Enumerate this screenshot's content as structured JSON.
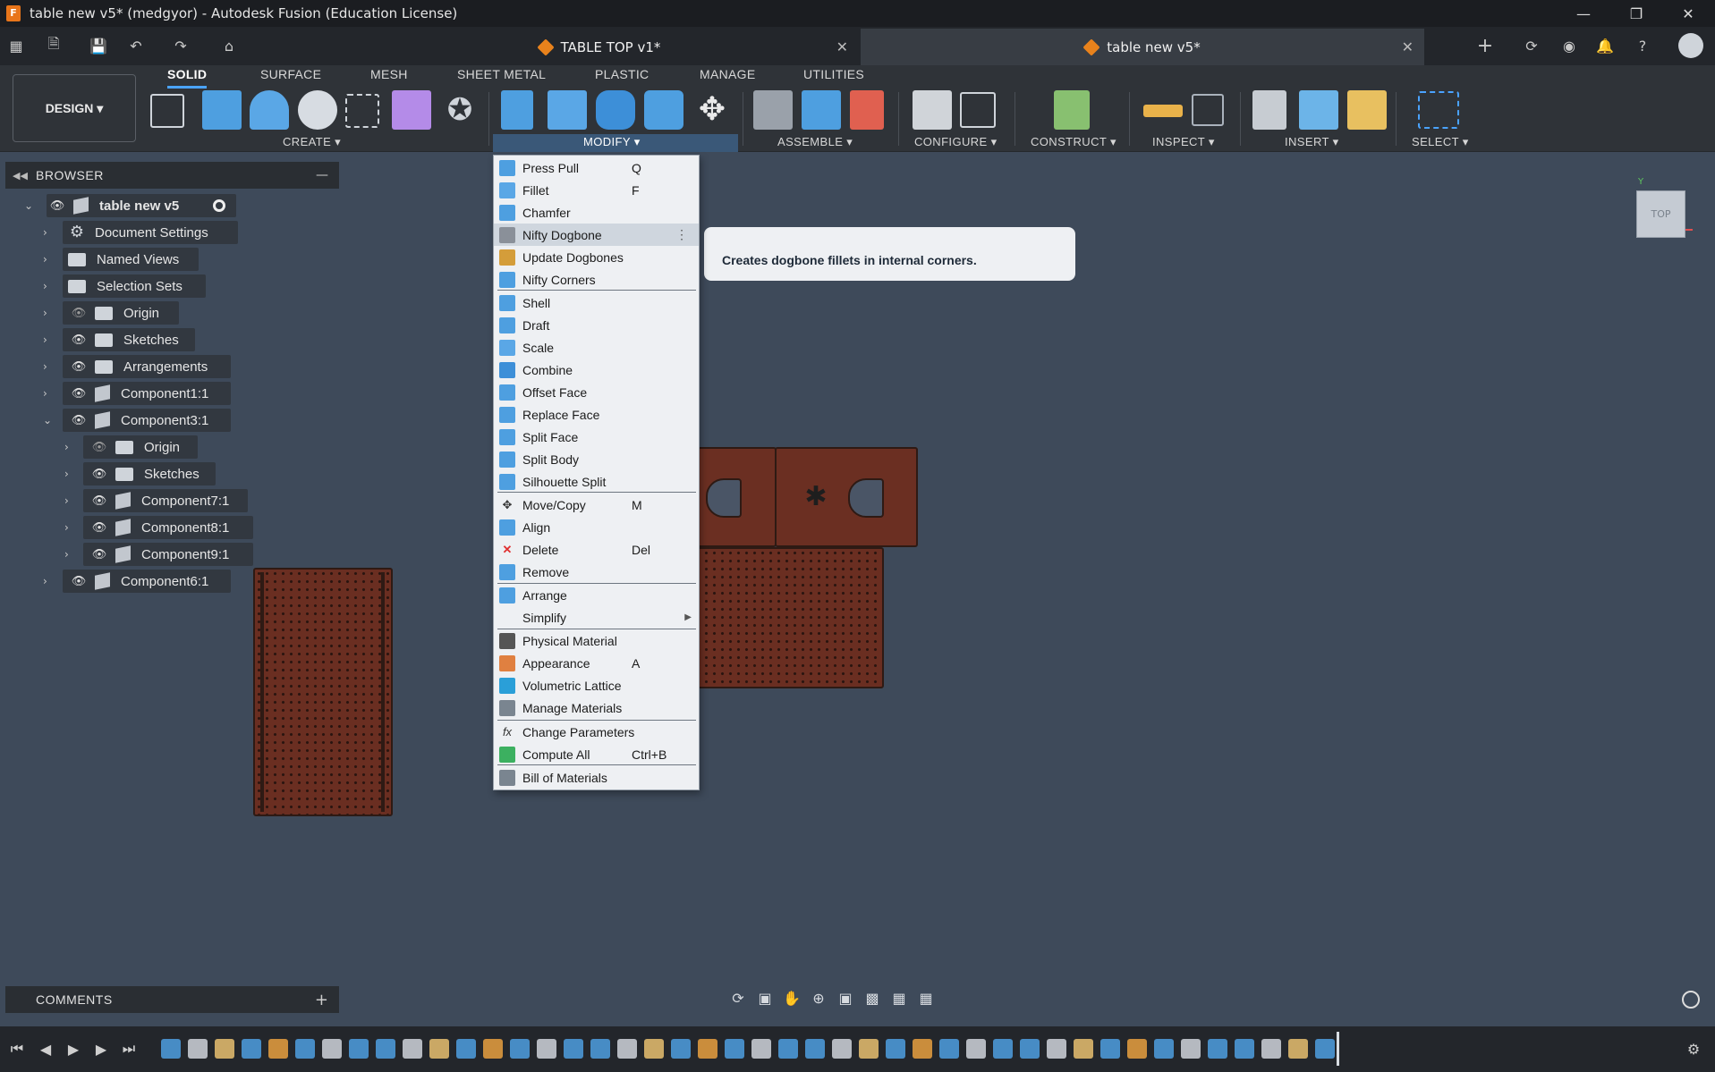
{
  "window": {
    "title": "table new v5* (medgyor) - Autodesk Fusion (Education License)",
    "app_icon_letter": "F",
    "controls": [
      "minimize-icon",
      "restore-icon",
      "close-icon"
    ]
  },
  "doc_tabs": [
    {
      "label": "TABLE TOP v1*",
      "active": false
    },
    {
      "label": "table new v5*",
      "active": true
    }
  ],
  "toolbar": {
    "workspace": "DESIGN",
    "workspace_tabs": [
      "SOLID",
      "SURFACE",
      "MESH",
      "SHEET METAL",
      "PLASTIC",
      "MANAGE",
      "UTILITIES"
    ],
    "groups": [
      "CREATE",
      "MODIFY",
      "ASSEMBLE",
      "CONFIGURE",
      "CONSTRUCT",
      "INSPECT",
      "INSERT",
      "SELECT"
    ]
  },
  "browser": {
    "title": "BROWSER",
    "root": "table new v5",
    "items": [
      {
        "label": "Document Settings"
      },
      {
        "label": "Named Views"
      },
      {
        "label": "Selection Sets"
      },
      {
        "label": "Origin"
      },
      {
        "label": "Sketches"
      },
      {
        "label": "Arrangements"
      },
      {
        "label": "Component1:1"
      },
      {
        "label": "Component3:1"
      },
      {
        "label": "Origin"
      },
      {
        "label": "Sketches"
      },
      {
        "label": "Component7:1"
      },
      {
        "label": "Component8:1"
      },
      {
        "label": "Component9:1"
      },
      {
        "label": "Component6:1"
      }
    ]
  },
  "comments": {
    "title": "COMMENTS"
  },
  "modify_menu": {
    "items": [
      {
        "label": "Press Pull",
        "shortcut": "Q",
        "icon": "press-pull-icon"
      },
      {
        "label": "Fillet",
        "shortcut": "F",
        "icon": "fillet-icon"
      },
      {
        "label": "Chamfer",
        "shortcut": "",
        "icon": "chamfer-icon"
      },
      {
        "label": "Nifty Dogbone",
        "shortcut": "",
        "icon": "dogbone-icon"
      },
      {
        "label": "Update Dogbones",
        "shortcut": "",
        "icon": "update-dogbones-icon"
      },
      {
        "label": "Nifty Corners",
        "shortcut": "",
        "icon": "corners-icon"
      },
      {
        "label": "Shell",
        "shortcut": "",
        "icon": "shell-icon"
      },
      {
        "label": "Draft",
        "shortcut": "",
        "icon": "draft-icon"
      },
      {
        "label": "Scale",
        "shortcut": "",
        "icon": "scale-icon"
      },
      {
        "label": "Combine",
        "shortcut": "",
        "icon": "combine-icon"
      },
      {
        "label": "Offset Face",
        "shortcut": "",
        "icon": "offset-face-icon"
      },
      {
        "label": "Replace Face",
        "shortcut": "",
        "icon": "replace-face-icon"
      },
      {
        "label": "Split Face",
        "shortcut": "",
        "icon": "split-face-icon"
      },
      {
        "label": "Split Body",
        "shortcut": "",
        "icon": "split-body-icon"
      },
      {
        "label": "Silhouette Split",
        "shortcut": "",
        "icon": "silhouette-split-icon"
      },
      {
        "label": "Move/Copy",
        "shortcut": "M",
        "icon": "move-icon"
      },
      {
        "label": "Align",
        "shortcut": "",
        "icon": "align-icon"
      },
      {
        "label": "Delete",
        "shortcut": "Del",
        "icon": "delete-icon"
      },
      {
        "label": "Remove",
        "shortcut": "",
        "icon": "remove-icon"
      },
      {
        "label": "Arrange",
        "shortcut": "",
        "icon": "arrange-icon"
      },
      {
        "label": "Simplify",
        "shortcut": "",
        "icon": "submenu-arrow-icon"
      },
      {
        "label": "Physical Material",
        "shortcut": "",
        "icon": "physical-material-icon"
      },
      {
        "label": "Appearance",
        "shortcut": "A",
        "icon": "appearance-icon"
      },
      {
        "label": "Volumetric Lattice",
        "shortcut": "",
        "icon": "lattice-icon"
      },
      {
        "label": "Manage Materials",
        "shortcut": "",
        "icon": "manage-materials-icon"
      },
      {
        "label": "Change Parameters",
        "shortcut": "",
        "icon": "fx-icon"
      },
      {
        "label": "Compute All",
        "shortcut": "Ctrl+B",
        "icon": "compute-icon"
      },
      {
        "label": "Bill of Materials",
        "shortcut": "",
        "icon": "bom-icon"
      }
    ],
    "hovered": "Nifty Dogbone"
  },
  "tooltip": {
    "text": "Creates dogbone fillets in internal corners."
  },
  "viewcube": {
    "face": "TOP"
  },
  "colors": {
    "accent": "#4aa3ff",
    "canvas": "#3e4a5a",
    "wood": "#6b2f22",
    "fusion_orange": "#e8751a"
  }
}
